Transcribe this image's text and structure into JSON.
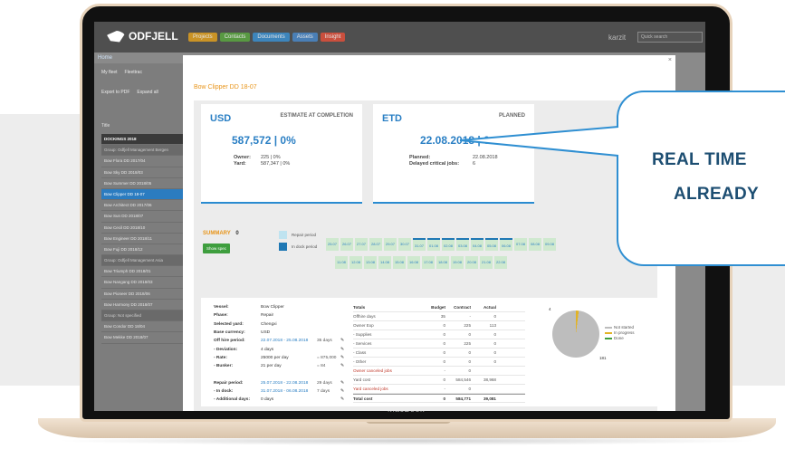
{
  "screen": {
    "brand_logo": "ODFJELL",
    "nav_tabs": [
      {
        "label": "Projects",
        "color": "#e0a020"
      },
      {
        "label": "Contacts",
        "color": "#5aa640"
      },
      {
        "label": "Documents",
        "color": "#3a8fd0"
      },
      {
        "label": "Assets",
        "color": "#4a88c8"
      },
      {
        "label": "Insight",
        "color": "#e0503a"
      }
    ],
    "company": "karzit",
    "search_placeholder": "Quick search",
    "breadcrumb": "Home",
    "toolbar": {
      "my_fleet": "My fleet",
      "fleettrac": "Fleettrac",
      "export_pdf": "Export to PDF",
      "expand_all": "Expand all"
    },
    "column_title": "Title",
    "sidebar": [
      {
        "label": "DOCKINGS 2018",
        "kind": "dark"
      },
      {
        "label": "Group: Odfjell Management Bergen",
        "kind": "group"
      },
      {
        "label": "Bow Flora DD 2017/04",
        "kind": "item"
      },
      {
        "label": "Bow Sky DD 2018/03",
        "kind": "item"
      },
      {
        "label": "Bow Summer DD 2018/05",
        "kind": "item"
      },
      {
        "label": "Bow Clipper DD 18-07",
        "kind": "active"
      },
      {
        "label": "Bow Architect DD 2017/06",
        "kind": "item"
      },
      {
        "label": "Bow Sun DD 2018/07",
        "kind": "item"
      },
      {
        "label": "Bow Cecil DD 2018/10",
        "kind": "item"
      },
      {
        "label": "Bow Engineer DD 2018/11",
        "kind": "item"
      },
      {
        "label": "Bow Fuji DD 2018/12",
        "kind": "item"
      },
      {
        "label": "Group: Odfjell Management Asia",
        "kind": "group"
      },
      {
        "label": "Bow Triumph DD 2018/01",
        "kind": "item"
      },
      {
        "label": "Bow Nangang DD 2018/03",
        "kind": "item"
      },
      {
        "label": "Bow Pioneer DD 2018/06",
        "kind": "item"
      },
      {
        "label": "Bow Harmony DD 2018/07",
        "kind": "item"
      },
      {
        "label": "Group: Not specified",
        "kind": "group"
      },
      {
        "label": "Bow Condor DD 18/04",
        "kind": "item"
      },
      {
        "label": "Bow Mekke DD 2018/07",
        "kind": "item"
      }
    ]
  },
  "modal": {
    "close": "×",
    "title": "Bow Clipper DD 18-07",
    "usd_card": {
      "head": "USD",
      "caption": "ESTIMATE AT COMPLETION",
      "value": "587,572 | 0%",
      "owner_label": "Owner:",
      "owner_value": "225  |  0%",
      "yard_label": "Yard:",
      "yard_value": "587,347  |  0%"
    },
    "etd_card": {
      "head": "ETD",
      "caption": "PLANNED",
      "value": "22.08.2018 | 0",
      "planned_label": "Planned:",
      "planned_value": "22.08.2018",
      "delayed_label": "Delayed critical jobs:",
      "delayed_value": "6"
    },
    "summary": {
      "label": "SUMMARY",
      "count": "0",
      "show_spec": "Show spec",
      "repair_period": "Repair period",
      "in_dock_period": "In dock period"
    },
    "timeline_row1": [
      "25.07",
      "26.07",
      "27.07",
      "28.07",
      "29.07",
      "30.07",
      "31.07",
      "01.08",
      "02.08",
      "03.08",
      "04.08",
      "05.08",
      "06.08",
      "07.08",
      "08.08",
      "09.08"
    ],
    "timeline_row2": [
      "11.08",
      "12.08",
      "13.08",
      "14.08",
      "15.08",
      "16.08",
      "17.08",
      "18.08",
      "19.08",
      "20.08",
      "21.08",
      "22.08"
    ],
    "details": [
      {
        "k": "Vessel:",
        "v": "Bow Clipper",
        "e": ""
      },
      {
        "k": "Phase:",
        "v": "Repair",
        "e": ""
      },
      {
        "k": "Selected yard:",
        "v": "Chengxi",
        "e": ""
      },
      {
        "k": "Base currency:",
        "v": "USD",
        "e": ""
      },
      {
        "k": "Off hire period:",
        "v": "22.07.2018 - 25.08.2018",
        "e": "35 days"
      },
      {
        "k": "- Deviation:",
        "v": "4 days",
        "e": ""
      },
      {
        "k": "- Rate:",
        "v": "25000 per day",
        "e": "= 875,000"
      },
      {
        "k": "- Bunker:",
        "v": "21 per day",
        "e": "= 84"
      },
      {
        "k": "",
        "v": "",
        "e": ""
      },
      {
        "k": "Repair period:",
        "v": "25.07.2018 - 22.08.2018",
        "e": "29 days"
      },
      {
        "k": "- In dock:",
        "v": "31.07.2018 - 06.08.2018",
        "e": "7 days"
      },
      {
        "k": "- Additional days:",
        "v": "0 days",
        "e": ""
      }
    ],
    "totals": {
      "headers": [
        "Totals",
        "Budget",
        "Contract",
        "Actual"
      ],
      "rows": [
        {
          "c": [
            "Offhire days",
            "35",
            "-",
            "0"
          ],
          "style": ""
        },
        {
          "c": [
            "Owner Exp",
            "0",
            "225",
            "113"
          ],
          "style": ""
        },
        {
          "c": [
            "- Supplies",
            "0",
            "0",
            "0"
          ],
          "style": ""
        },
        {
          "c": [
            "- Services",
            "0",
            "225",
            "0"
          ],
          "style": ""
        },
        {
          "c": [
            "- Class",
            "0",
            "0",
            "0"
          ],
          "style": ""
        },
        {
          "c": [
            "- Other",
            "0",
            "0",
            "0"
          ],
          "style": ""
        },
        {
          "c": [
            "Owner canceled jobs",
            "-",
            "0",
            ""
          ],
          "style": "red"
        },
        {
          "c": [
            "Yard cost",
            "0",
            "584,546",
            "38,968"
          ],
          "style": ""
        },
        {
          "c": [
            "Yard canceled jobs",
            "-",
            "0",
            ""
          ],
          "style": "red"
        },
        {
          "c": [
            "Total cost",
            "0",
            "584,771",
            "39,081"
          ],
          "style": "bold"
        }
      ]
    },
    "pie_labels": {
      "top": "4",
      "bottom": "181"
    },
    "pie_legend": [
      {
        "label": "Not started",
        "color": "#bdbdbd"
      },
      {
        "label": "In progress",
        "color": "#e2b325"
      },
      {
        "label": "Done",
        "color": "#3e9e3e"
      }
    ]
  },
  "callout": {
    "line1": "REAL TIME",
    "line2": "ALREADY"
  },
  "laptop_label": "MacBook"
}
